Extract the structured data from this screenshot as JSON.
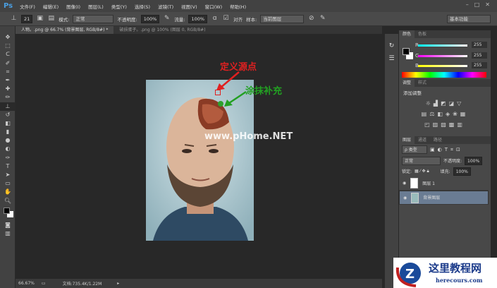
{
  "app": {
    "logo": "Ps",
    "menu": [
      "文件(F)",
      "编辑(E)",
      "图像(I)",
      "图层(L)",
      "类型(Y)",
      "选择(S)",
      "滤镜(T)",
      "视图(V)",
      "窗口(W)",
      "帮助(H)"
    ]
  },
  "options": {
    "brush_size": "21",
    "mode_label": "模式:",
    "mode": "正常",
    "opacity_label": "不透明度:",
    "opacity": "100%",
    "flow_label": "流量:",
    "flow": "100%",
    "aligned_label": "对齐",
    "sample_label": "样本:",
    "sample": "当前图层",
    "workspace": "基本功能"
  },
  "tabs": [
    {
      "label": "人物。.png @ 66.7% (背景图层, RGB/8#) *"
    },
    {
      "label": "破损蛋子。.png @ 100% (图层 0, RGB/8#)"
    }
  ],
  "canvas": {
    "annotation_source": "定义源点",
    "annotation_paint": "涂抹补充",
    "watermark": "www.pHome.NET",
    "colors": {
      "source": "#e02020",
      "paint": "#22a022"
    }
  },
  "status": {
    "zoom": "66.67%",
    "doc": "文档:735.4K/1.22M"
  },
  "color_panel": {
    "tabs": [
      "颜色",
      "色板"
    ],
    "r_label": "R",
    "g_label": "G",
    "b_label": "B",
    "r": "255",
    "g": "255",
    "b": "255"
  },
  "adjust_panel": {
    "tabs": [
      "调整",
      "样式"
    ],
    "title": "添加调整"
  },
  "layers_panel": {
    "tabs": [
      "图层",
      "通道",
      "路径"
    ],
    "filter": "ρ 类型",
    "blend": "正常",
    "opacity_label": "不透明度:",
    "opacity": "100%",
    "lock_label": "锁定:",
    "fill_label": "填充:",
    "fill": "100%",
    "layers": [
      {
        "name": "图层 1"
      },
      {
        "name": "背景图层",
        "selected": true
      }
    ]
  },
  "site_watermark": {
    "title": "这里教程网",
    "url": "herecours.com"
  }
}
